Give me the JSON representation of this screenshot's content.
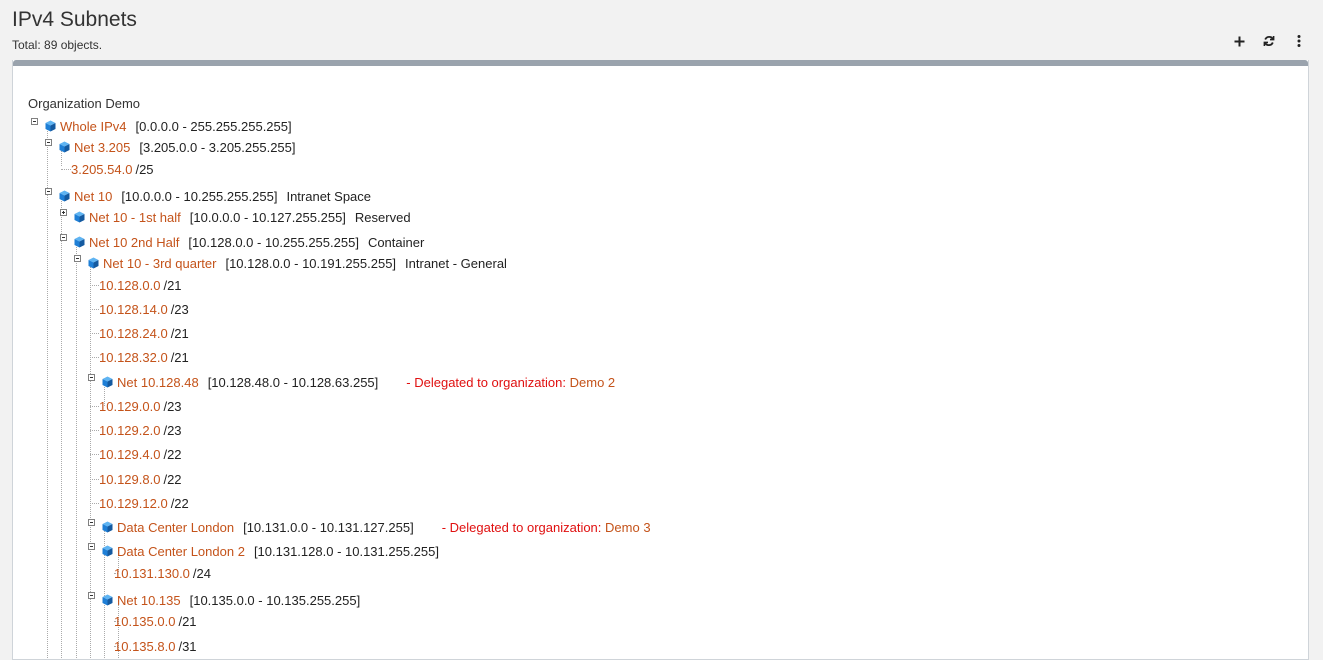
{
  "header": {
    "title": "IPv4 Subnets",
    "subtitle": "Total: 89 objects."
  },
  "toolbar": {
    "icons": [
      "plus-icon",
      "refresh-icon",
      "more-vertical-icon"
    ]
  },
  "colors": {
    "link": "#c4531a",
    "delegated": "#e01010",
    "cube": "#1f7fd6"
  },
  "tree": {
    "org_label": "Organization Demo",
    "delegated_prefix": "- Delegated to organization:",
    "nodes": [
      {
        "label": "Whole IPv4",
        "range": "[0.0.0.0 - 255.255.255.255]"
      },
      {
        "label": "Net 3.205",
        "range": "[3.205.0.0 - 3.205.255.255]"
      },
      {
        "label": "3.205.54.0",
        "prefix": "/25"
      },
      {
        "label": "Net 10",
        "range": "[10.0.0.0 - 10.255.255.255]",
        "desc": "Intranet Space"
      },
      {
        "label": "Net 10 - 1st half",
        "range": "[10.0.0.0 - 10.127.255.255]",
        "desc": "Reserved"
      },
      {
        "label": "Net 10 2nd Half",
        "range": "[10.128.0.0 - 10.255.255.255]",
        "desc": "Container"
      },
      {
        "label": "Net 10 - 3rd quarter",
        "range": "[10.128.0.0 - 10.191.255.255]",
        "desc": "Intranet - General"
      },
      {
        "label": "10.128.0.0",
        "prefix": "/21"
      },
      {
        "label": "10.128.14.0",
        "prefix": "/23"
      },
      {
        "label": "10.128.24.0",
        "prefix": "/21"
      },
      {
        "label": "10.128.32.0",
        "prefix": "/21"
      },
      {
        "label": "Net 10.128.48",
        "range": "[10.128.48.0 - 10.128.63.255]",
        "delegated": "Demo 2"
      },
      {
        "label": "10.129.0.0",
        "prefix": "/23"
      },
      {
        "label": "10.129.2.0",
        "prefix": "/23"
      },
      {
        "label": "10.129.4.0",
        "prefix": "/22"
      },
      {
        "label": "10.129.8.0",
        "prefix": "/22"
      },
      {
        "label": "10.129.12.0",
        "prefix": "/22"
      },
      {
        "label": "Data Center London",
        "range": "[10.131.0.0 - 10.131.127.255]",
        "delegated": "Demo 3"
      },
      {
        "label": "Data Center London 2",
        "range": "[10.131.128.0 - 10.131.255.255]"
      },
      {
        "label": "10.131.130.0",
        "prefix": "/24"
      },
      {
        "label": "Net 10.135",
        "range": "[10.135.0.0 - 10.135.255.255]"
      },
      {
        "label": "10.135.0.0",
        "prefix": "/21"
      },
      {
        "label": "10.135.8.0",
        "prefix": "/31"
      }
    ]
  }
}
